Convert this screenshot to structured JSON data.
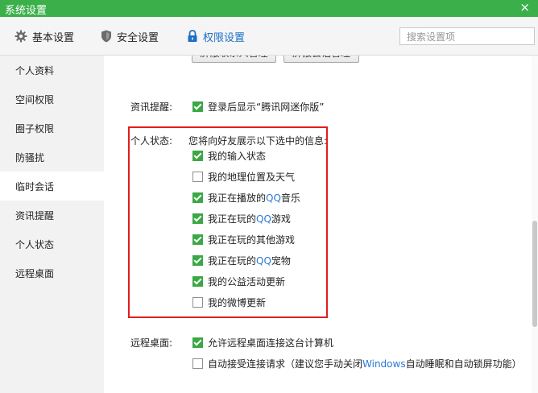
{
  "window": {
    "title": "系统设置",
    "close_label": "×"
  },
  "tabs": [
    {
      "label": "基本设置",
      "icon": "gear-icon",
      "active": false
    },
    {
      "label": "安全设置",
      "icon": "shield-icon",
      "active": false
    },
    {
      "label": "权限设置",
      "icon": "lock-icon",
      "active": true
    }
  ],
  "search": {
    "placeholder": "搜索设置项"
  },
  "sidebar": {
    "items": [
      {
        "label": "个人资料"
      },
      {
        "label": "空间权限"
      },
      {
        "label": "圈子权限"
      },
      {
        "label": "防骚扰"
      },
      {
        "label": "临时会话",
        "active": true
      },
      {
        "label": "资讯提醒"
      },
      {
        "label": "个人状态"
      },
      {
        "label": "远程桌面"
      }
    ]
  },
  "main": {
    "top_buttons": [
      {
        "label": "屏蔽联系人管理"
      },
      {
        "label": "屏蔽会话管理"
      }
    ],
    "news": {
      "label": "资讯提醒:",
      "option": {
        "label": "登录后显示“腾讯网迷你版”",
        "checked": true
      }
    },
    "status": {
      "label": "个人状态:",
      "intro": "您将向好友展示以下选中的信息:",
      "options": [
        {
          "label": "我的输入状态",
          "checked": true
        },
        {
          "label": "我的地理位置及天气",
          "checked": false
        },
        {
          "label_pre": "我正在播放的",
          "label_hl": "QQ",
          "label_post": "音乐",
          "checked": true
        },
        {
          "label_pre": "我正在玩的",
          "label_hl": "QQ",
          "label_post": "游戏",
          "checked": true
        },
        {
          "label": "我正在玩的其他游戏",
          "checked": true
        },
        {
          "label_pre": "我正在玩的",
          "label_hl": "QQ",
          "label_post": "宠物",
          "checked": true
        },
        {
          "label": "我的公益活动更新",
          "checked": true
        },
        {
          "label": "我的微博更新",
          "checked": false
        }
      ]
    },
    "remote": {
      "label": "远程桌面:",
      "options": [
        {
          "label": "允许远程桌面连接这台计算机",
          "checked": true
        },
        {
          "label_pre": "自动接受连接请求（建议您手动关闭",
          "label_hl": "Windows",
          "label_post": "自动睡眠和自动锁屏功能）",
          "checked": false
        }
      ]
    }
  },
  "colors": {
    "titlebar": "#3bb04a",
    "checkbox_on": "#3aa844",
    "highlight_box": "#e01e1e",
    "active_tab": "#1e6fc4",
    "link_text": "#2a7ad4"
  }
}
